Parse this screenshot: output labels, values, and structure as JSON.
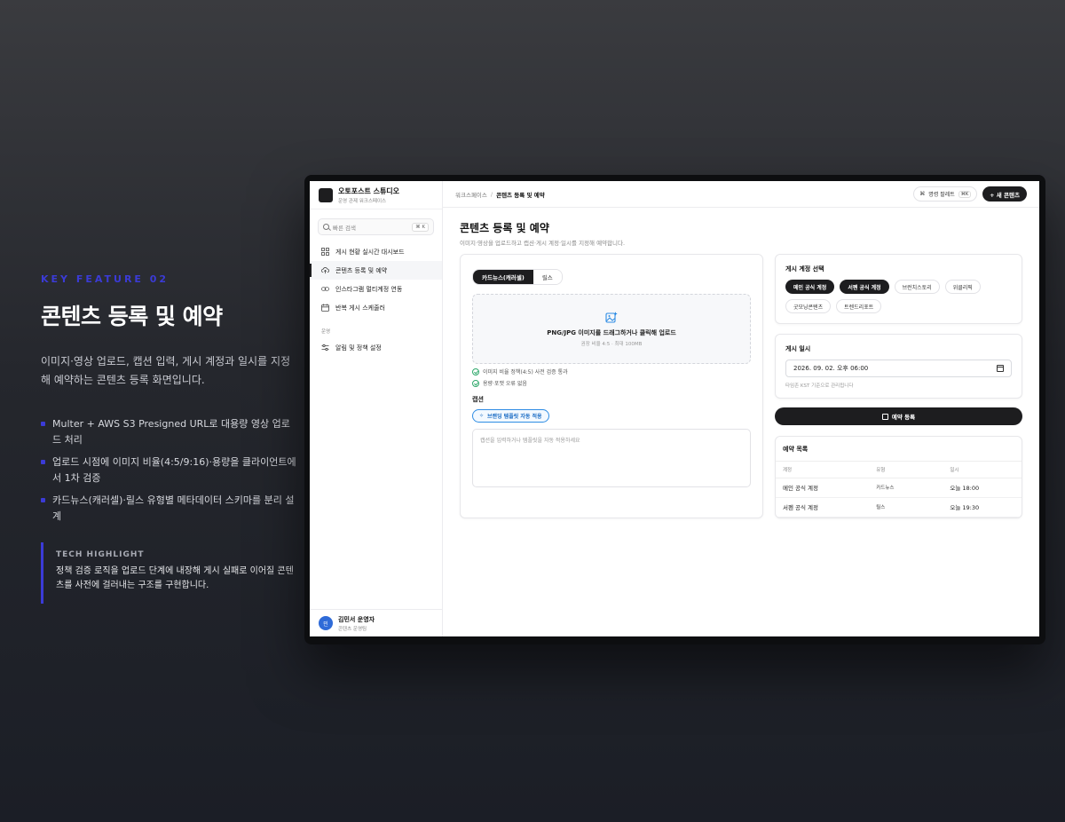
{
  "marketing": {
    "tag": "KEY FEATURE 02",
    "title": "콘텐츠 등록 및 예약",
    "description": "이미지·영상 업로드, 캡션 입력, 게시 계정과 일시를 지정해 예약하는 콘텐츠 등록 화면입니다.",
    "bullets": [
      "Multer + AWS S3 Presigned URL로 대용량 영상 업로드 처리",
      "업로드 시점에 이미지 비율(4:5/9:16)·용량을 클라이언트에서 1차 검증",
      "카드뉴스(캐러셀)·릴스 유형별 메타데이터 스키마를 분리 설계"
    ],
    "highlight_label": "TECH HIGHLIGHT",
    "highlight_text": "정책 검증 로직을 업로드 단계에 내장해 게시 실패로 이어질 콘텐츠를 사전에 걸러내는 구조를 구현합니다."
  },
  "app": {
    "brand_name": "오토포스트 스튜디오",
    "brand_sub": "운영 관제 워크스페이스",
    "search_placeholder": "빠른 검색",
    "search_kbd": "⌘ K",
    "nav": [
      {
        "label": "게시 현황 실시간 대시보드",
        "icon": "grid-icon"
      },
      {
        "label": "콘텐츠 등록 및 예약",
        "icon": "upload-cloud-icon"
      },
      {
        "label": "인스타그램 멀티계정 연동",
        "icon": "link-icon"
      },
      {
        "label": "반복 게시 스케줄러",
        "icon": "calendar-icon"
      }
    ],
    "nav_section": "운영",
    "nav_settings": {
      "label": "알림 및 정책 설정",
      "icon": "sliders-icon"
    },
    "user": {
      "initial": "민",
      "name": "김민서 운영자",
      "role": "콘텐츠 운영팀"
    }
  },
  "topbar": {
    "crumb_root": "워크스페이스",
    "crumb_sep": "/",
    "crumb_current": "콘텐츠 등록 및 예약",
    "command_label": "명령 팔레트",
    "command_kbd": "⌘K",
    "new_button": "+ 새 콘텐츠"
  },
  "page": {
    "title": "콘텐츠 등록 및 예약",
    "subtitle": "이미지·영상을 업로드하고 캡션·게시 계정·일시를 지정해 예약합니다."
  },
  "upload": {
    "tabs": [
      "카드뉴스(캐러셀)",
      "릴스"
    ],
    "dropzone_title": "PNG/JPG 이미지를 드래그하거나 클릭해 업로드",
    "dropzone_sub": "권장 비율 4:5 · 최대 100MB",
    "checks": [
      "이미지 비율 정책(4:5) 사전 검증 통과",
      "용량·포맷 오류 없음"
    ],
    "caption_label": "캡션",
    "template_button": "브랜딩 템플릿 자동 적용",
    "caption_placeholder": "캡션을 입력하거나 템플릿을 자동 적용하세요"
  },
  "accounts": {
    "title": "게시 계정 선택",
    "chips": [
      {
        "label": "메인 공식 계정",
        "selected": true
      },
      {
        "label": "서펜 공식 계정",
        "selected": true
      },
      {
        "label": "브런치스토리",
        "selected": false
      },
      {
        "label": "위클리픽",
        "selected": false
      },
      {
        "label": "굿모닝콘텐츠",
        "selected": false
      },
      {
        "label": "트렌드리포트",
        "selected": false
      }
    ]
  },
  "schedule": {
    "title": "게시 일시",
    "value": "2026. 09. 02. 오후 06:00",
    "hint": "타임존 KST 기준으로 관리됩니다"
  },
  "reserve_button": "예약 등록",
  "reservations": {
    "title": "예약 목록",
    "headers": [
      "계정",
      "유형",
      "일시"
    ],
    "rows": [
      {
        "account": "메인 공식 계정",
        "type": "카드뉴스",
        "time": "오늘 18:00"
      },
      {
        "account": "서펜 공식 계정",
        "type": "릴스",
        "time": "오늘 19:30"
      }
    ]
  }
}
